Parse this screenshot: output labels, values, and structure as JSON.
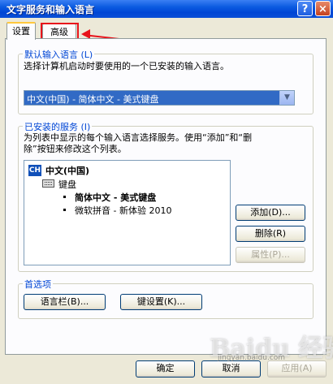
{
  "window": {
    "title": "文字服务和输入语言",
    "help_label": "?",
    "close_label": "×"
  },
  "tabs": [
    {
      "label": "设置",
      "active": true
    },
    {
      "label": "高级",
      "active": false
    }
  ],
  "default_language": {
    "title": "默认输入语言 (L)",
    "description": "选择计算机启动时要使用的一个已安装的输入语言。",
    "selected": "中文(中国) - 简体中文 - 美式键盘"
  },
  "installed_services": {
    "title": "已安装的服务 (I)",
    "description_line1": "为列表中显示的每个输入语言选择服务。使用“添加”和“删",
    "description_line2": "除”按钮来修改这个列表。",
    "tree": {
      "language_badge": "CH",
      "language": "中文(中国)",
      "category": "键盘",
      "items": [
        "简体中文 - 美式键盘",
        "微软拼音 - 新体验 2010"
      ]
    },
    "buttons": {
      "add": "添加(D)...",
      "remove": "删除(R)",
      "properties": "属性(P)..."
    }
  },
  "preferences": {
    "title": "首选项",
    "buttons": {
      "language_bar": "语言栏(B)...",
      "key_settings": "键设置(K)..."
    }
  },
  "footer": {
    "ok": "确定",
    "cancel": "取消",
    "apply": "应用(A)"
  },
  "watermark": {
    "brand": "Baidu 经验",
    "url": "jingyan.baidu.com"
  },
  "colors": {
    "title_bar": "#0a5ae0",
    "annotation": "#e8131b",
    "group_title": "#0046d5"
  }
}
